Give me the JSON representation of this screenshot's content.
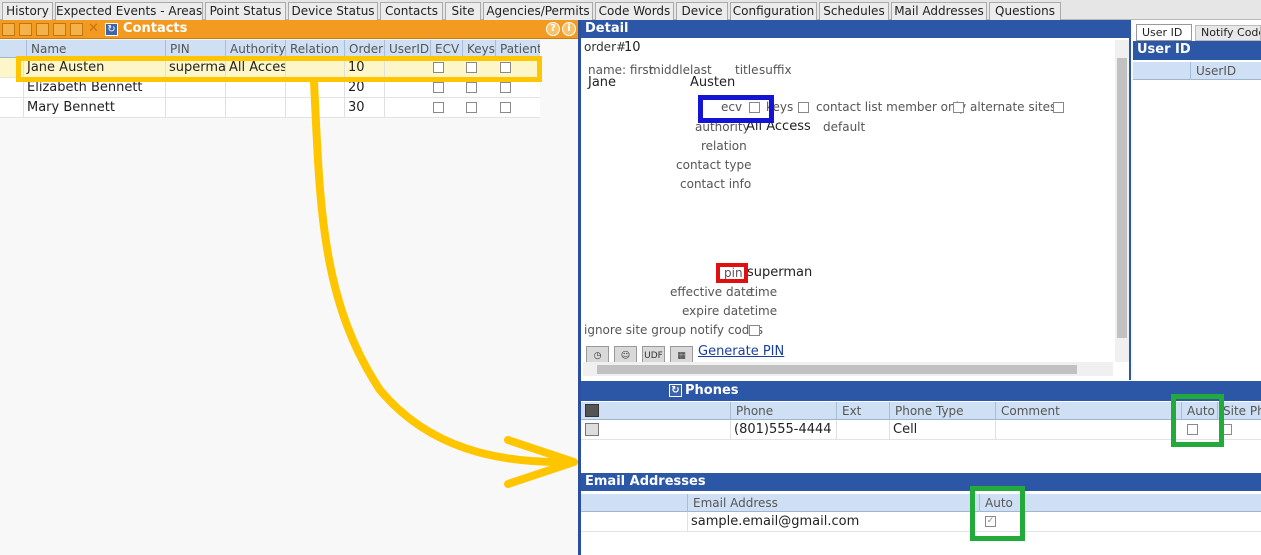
{
  "tabs": [
    "History",
    "Expected Events - Areas",
    "Point Status",
    "Device Status",
    "Contacts",
    "Site",
    "Agencies/Permits",
    "Code Words",
    "Device",
    "Configuration",
    "Schedules",
    "Mail Addresses",
    "Questions"
  ],
  "contacts_panel": {
    "title": "Contacts",
    "help_icon": "?",
    "info_icon": "i",
    "columns": [
      "Name",
      "PIN",
      "Authority",
      "Relation",
      "Order#",
      "UserID",
      "ECV",
      "Keys",
      "Patient"
    ],
    "rows": [
      {
        "name": "Jane Austen",
        "pin": "supermar",
        "authority": "All Access",
        "relation": "",
        "order": "10",
        "userid": ""
      },
      {
        "name": "Elizabeth Bennett",
        "pin": "",
        "authority": "",
        "relation": "",
        "order": "20",
        "userid": ""
      },
      {
        "name": "Mary Bennett",
        "pin": "",
        "authority": "",
        "relation": "",
        "order": "30",
        "userid": ""
      }
    ]
  },
  "detail": {
    "title": "Detail",
    "order_label": "order#",
    "order_value": "10",
    "name_labels": [
      "name: first",
      "middle",
      "last",
      "title",
      "suffix"
    ],
    "first_name": "Jane",
    "last_name": "Austen",
    "ecv_label": "ecv",
    "keys_label": "keys",
    "contact_list_label": "contact list member only",
    "alternate_sites_label": "alternate sites",
    "authority_label": "authority",
    "authority_value": "All Access",
    "default_label": "default",
    "relation_label": "relation",
    "contact_type_label": "contact type",
    "contact_info_label": "contact info",
    "pin_label": "pin",
    "pin_value": "superman",
    "effective_date_label": "effective date",
    "expire_date_label": "expire date",
    "time_label": "time",
    "ignore_label": "ignore site group notify codes",
    "udf_label": "UDF",
    "generate_pin": "Generate PIN"
  },
  "user_id_panel": {
    "tabs": [
      "User ID",
      "Notify Code"
    ],
    "title": "User ID",
    "column": "UserID"
  },
  "phones": {
    "title": "Phones",
    "columns": [
      "Phone",
      "Ext",
      "Phone Type",
      "Comment",
      "Auto",
      "Site Pho"
    ],
    "rows": [
      {
        "phone": "(801)555-4444",
        "ext": "",
        "type": "Cell",
        "comment": ""
      }
    ]
  },
  "emails": {
    "title": "Email Addresses",
    "columns": [
      "Email Address",
      "Auto"
    ],
    "rows": [
      {
        "email": "sample.email@gmail.com"
      }
    ]
  },
  "colors": {
    "panel_orange": "#f39a20",
    "panel_blue": "#2c57a6",
    "highlight_yellow": "#ffc600",
    "box_blue": "#1414d2",
    "box_red": "#e01010",
    "box_green": "#22aa3a"
  }
}
